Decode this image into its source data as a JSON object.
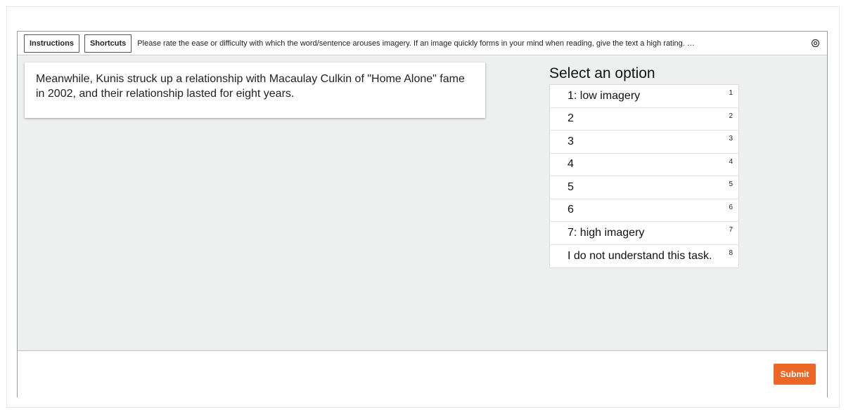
{
  "toolbar": {
    "instructions_label": "Instructions",
    "shortcuts_label": "Shortcuts",
    "instructions_text": "Please rate the ease or difficulty with which the word/sentence arouses imagery. If an image quickly forms in your mind when reading, give the text a high rating. …",
    "settings_icon": "settings-icon"
  },
  "task": {
    "text": "Meanwhile, Kunis struck up a relationship with Macaulay Culkin of \"Home Alone\" fame in 2002, and their relationship lasted for eight years."
  },
  "options": {
    "title": "Select an option",
    "items": [
      {
        "label": "1: low imagery",
        "hotkey": "1"
      },
      {
        "label": "2",
        "hotkey": "2"
      },
      {
        "label": "3",
        "hotkey": "3"
      },
      {
        "label": "4",
        "hotkey": "4"
      },
      {
        "label": "5",
        "hotkey": "5"
      },
      {
        "label": "6",
        "hotkey": "6"
      },
      {
        "label": "7: high imagery",
        "hotkey": "7"
      },
      {
        "label": "I do not understand this task.",
        "hotkey": "8"
      }
    ]
  },
  "footer": {
    "submit_label": "Submit"
  },
  "colors": {
    "submit_accent": "#ec6625",
    "workspace_bg": "#eef0ef"
  }
}
